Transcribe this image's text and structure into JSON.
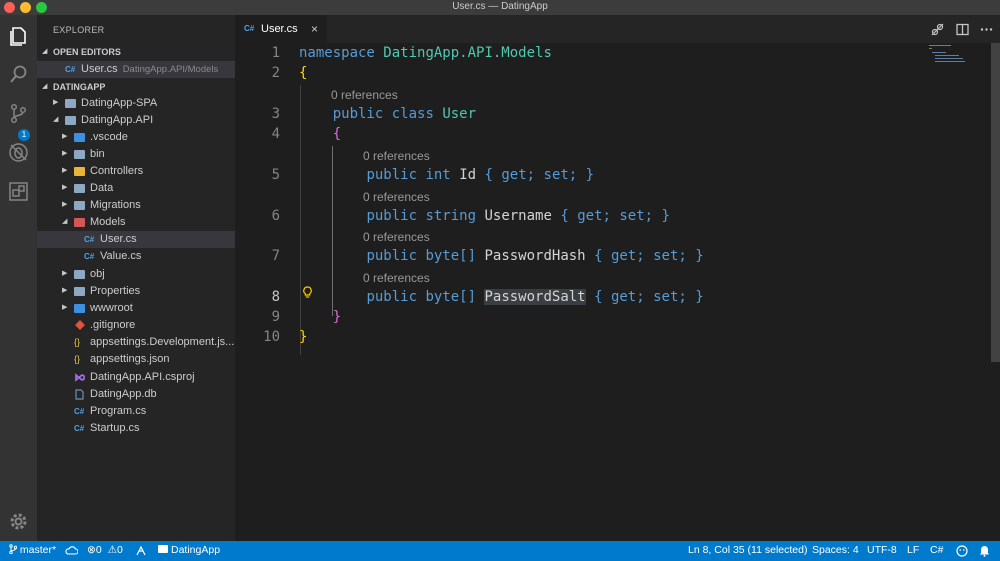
{
  "window": {
    "title": "User.cs — DatingApp",
    "traffic_colors": [
      "#ff5f57",
      "#febc2e",
      "#28c840"
    ]
  },
  "activity_bar": {
    "icons": [
      "files-icon",
      "search-icon",
      "source-control-icon",
      "debug-icon",
      "extensions-icon",
      "gear-icon"
    ],
    "scm_badge": "1"
  },
  "sidebar": {
    "title": "EXPLORER",
    "open_editors_label": "OPEN EDITORS",
    "open_editor": {
      "name": "User.cs",
      "path": "DatingApp.API/Models"
    },
    "workspace_label": "DATINGAPP",
    "tree": [
      {
        "label": "DatingApp-SPA",
        "icon": "folder"
      },
      {
        "label": "DatingApp.API",
        "icon": "folder"
      },
      {
        "label": ".vscode",
        "icon": "folder-blue"
      },
      {
        "label": "bin",
        "icon": "folder"
      },
      {
        "label": "Controllers",
        "icon": "folder-yellow"
      },
      {
        "label": "Data",
        "icon": "folder"
      },
      {
        "label": "Migrations",
        "icon": "folder"
      },
      {
        "label": "Models",
        "icon": "folder-red"
      },
      {
        "label": "User.cs",
        "icon": "csharp"
      },
      {
        "label": "Value.cs",
        "icon": "csharp"
      },
      {
        "label": "obj",
        "icon": "folder"
      },
      {
        "label": "Properties",
        "icon": "folder"
      },
      {
        "label": "wwwroot",
        "icon": "folder-blue"
      },
      {
        "label": ".gitignore",
        "icon": "git"
      },
      {
        "label": "appsettings.Development.js...",
        "icon": "json"
      },
      {
        "label": "appsettings.json",
        "icon": "json"
      },
      {
        "label": "DatingApp.API.csproj",
        "icon": "vs"
      },
      {
        "label": "DatingApp.db",
        "icon": "file"
      },
      {
        "label": "Program.cs",
        "icon": "csharp"
      },
      {
        "label": "Startup.cs",
        "icon": "csharp"
      }
    ]
  },
  "editor": {
    "tab": {
      "icon": "C#",
      "name": "User.cs",
      "close": "×"
    },
    "line_numbers": [
      "1",
      "2",
      "3",
      "4",
      "5",
      "6",
      "7",
      "8",
      "9",
      "10"
    ],
    "codelens": "0 references",
    "lines": {
      "l1": [
        "namespace",
        "DatingApp.API.Models"
      ],
      "l3": [
        "public",
        "class",
        "User"
      ],
      "l5": [
        "public",
        "int",
        "Id",
        "{",
        "get;",
        "set;",
        "}"
      ],
      "l6": [
        "public",
        "string",
        "Username",
        "{",
        "get;",
        "set;",
        "}"
      ],
      "l7": [
        "public",
        "byte[]",
        "PasswordHash",
        "{",
        "get;",
        "set;",
        "}"
      ],
      "l8": [
        "public",
        "byte[]",
        "PasswordSalt",
        "{",
        "get;",
        "set;",
        "}"
      ]
    },
    "open_brace": "{",
    "close_brace": "}",
    "scroll_fraction": 0.64
  },
  "status_bar": {
    "branch": "master*",
    "errors": "0",
    "warnings": "0",
    "folder": "DatingApp",
    "position": "Ln 8, Col 35 (11 selected)",
    "spaces": "Spaces: 4",
    "encoding": "UTF-8",
    "eol": "LF",
    "language": "C#"
  }
}
